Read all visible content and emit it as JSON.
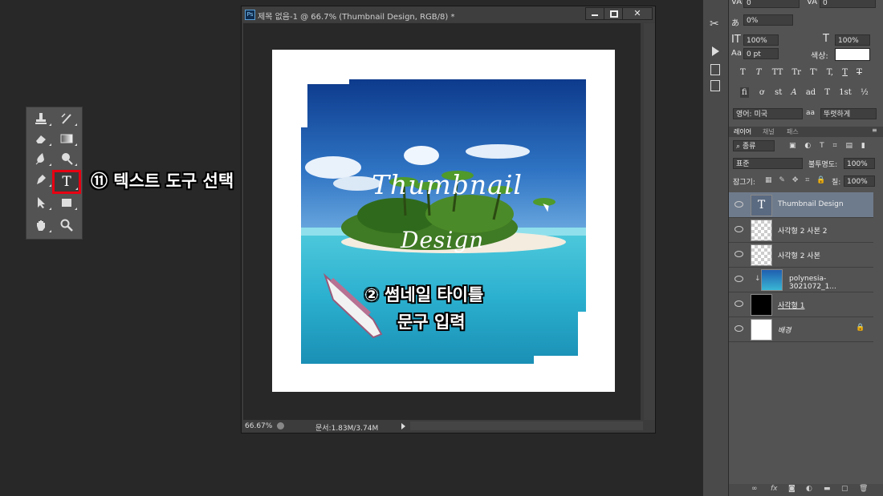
{
  "callouts": {
    "step1": "⑪ 텍스트 도구 선택",
    "step2_line1": "② 썸네일 타이틀",
    "step2_line2": "문구 입력"
  },
  "document": {
    "title": "제목 없음-1 @ 66.7% (Thumbnail Design, RGB/8) *",
    "zoom": "66.67%",
    "doc_size": "문서:1.83M/3.74M",
    "canvas_text_line1": "Thumbnail",
    "canvas_text_line2": "Design"
  },
  "character_panel": {
    "va_value": "0",
    "va_value2": "0",
    "tracking": "0%",
    "vscale": "100%",
    "hscale": "100%",
    "baseline": "0 pt",
    "color_label": "색상:",
    "language": "영어: 미국",
    "antialias_icon": "aa",
    "antialias": "뚜렷하게",
    "type_styles": [
      "T",
      "T",
      "TT",
      "Tr",
      "T'",
      "T,",
      "T",
      "T"
    ],
    "opentype": [
      "fi",
      "ơ",
      "st",
      "A",
      "ad",
      "T",
      "1st",
      "½"
    ]
  },
  "layers_panel": {
    "tabs": [
      "레이어",
      "채널",
      "패스"
    ],
    "filter_kind": "종류",
    "blend_mode": "표준",
    "opacity_label": "불투명도:",
    "opacity": "100%",
    "lock_label": "잠그기:",
    "fill_label": "칠:",
    "fill": "100%",
    "layers": [
      {
        "name": "Thumbnail Design",
        "type": "text",
        "selected": true
      },
      {
        "name": "사각형 2 사본 2",
        "type": "shape"
      },
      {
        "name": "사각형 2 사본",
        "type": "shape"
      },
      {
        "name": "polynesia-3021072_1...",
        "type": "image"
      },
      {
        "name": "사각형 1",
        "type": "shape-black"
      },
      {
        "name": "배경",
        "type": "background",
        "locked": true
      }
    ]
  },
  "colors": {
    "highlight_red": "#e60012",
    "selected_layer": "#6e7b8c",
    "panel_bg": "#535353",
    "app_bg": "#282828"
  }
}
